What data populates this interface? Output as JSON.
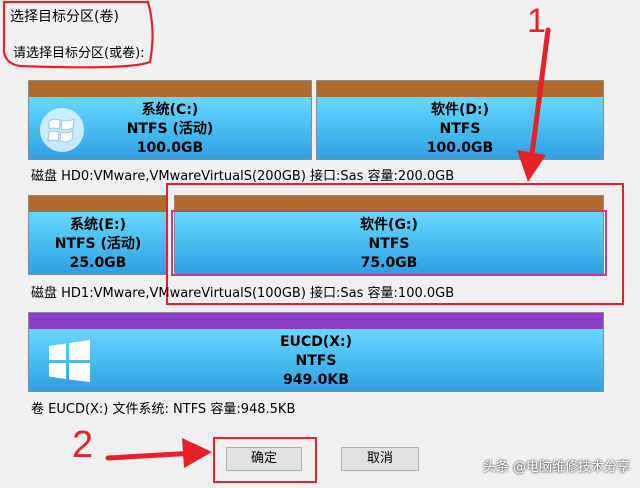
{
  "dialog": {
    "title": "选择目标分区(卷)",
    "prompt": "请选择目标分区(或卷):"
  },
  "disks": [
    {
      "partitions": [
        {
          "name": "系统(C:)",
          "fs": "NTFS (活动)",
          "size": "100.0GB",
          "icon": "windows-logo-icon"
        },
        {
          "name": "软件(D:)",
          "fs": "NTFS",
          "size": "100.0GB"
        }
      ],
      "info": "磁盘 HD0:VMware,VMwareVirtualS(200GB)  接口:Sas  容量:200.0GB"
    },
    {
      "partitions": [
        {
          "name": "系统(E:)",
          "fs": "NTFS (活动)",
          "size": "25.0GB"
        },
        {
          "name": "软件(G:)",
          "fs": "NTFS",
          "size": "75.0GB",
          "selected": true
        }
      ],
      "info": "磁盘 HD1:VMware,VMwareVirtualS(100GB)  接口:Sas  容量:100.0GB"
    },
    {
      "partitions": [
        {
          "name": "EUCD(X:)",
          "fs": "NTFS",
          "size": "949.0KB",
          "icon": "windows-logo-icon"
        }
      ],
      "info": "卷 EUCD(X:)   文件系统: NTFS  容量:948.5KB"
    }
  ],
  "buttons": {
    "ok": "确定",
    "cancel": "取消"
  },
  "annotations": {
    "step1": "1",
    "step2": "2"
  },
  "watermark": "头条 @电脑维修技术分享",
  "colors": {
    "partition_bar": "#b06a2b",
    "usb_bar": "#8c3ec9",
    "partition_face": "#2f9fe2",
    "annotation_red": "#e8202a",
    "selection_border": "#d13b7e"
  }
}
